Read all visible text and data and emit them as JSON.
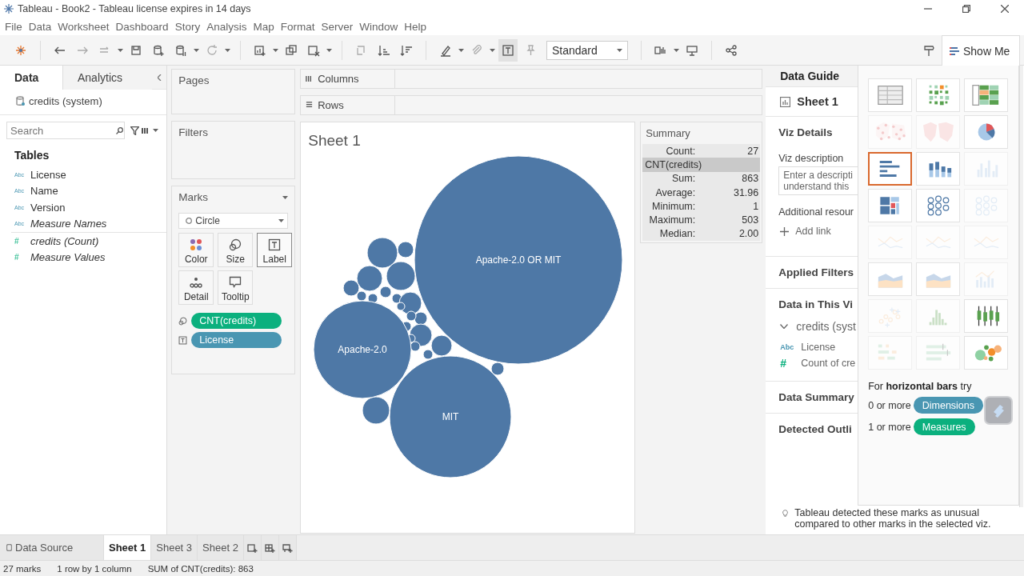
{
  "window": {
    "title": "Tableau - Book2 - Tableau license expires in 14 days"
  },
  "menu": [
    "File",
    "Data",
    "Worksheet",
    "Dashboard",
    "Story",
    "Analysis",
    "Map",
    "Format",
    "Server",
    "Window",
    "Help"
  ],
  "toolbar": {
    "view_mode": "Standard",
    "show_me_tab": "Show Me"
  },
  "data_pane": {
    "tabs": [
      {
        "label": "Data",
        "selected": true
      },
      {
        "label": "Analytics",
        "selected": false
      }
    ],
    "source": "credits (system)",
    "search": {
      "placeholder": "Search"
    },
    "heading": "Tables",
    "fields": [
      {
        "name": "License",
        "kind": "dimension",
        "icon_text": "Abc",
        "generated": false
      },
      {
        "name": "Name",
        "kind": "dimension",
        "icon_text": "Abc",
        "generated": false
      },
      {
        "name": "Version",
        "kind": "dimension",
        "icon_text": "Abc",
        "generated": false
      },
      {
        "name": "Measure Names",
        "kind": "dimension",
        "icon_text": "Abc",
        "generated": true
      },
      {
        "name": "credits (Count)",
        "kind": "measure",
        "icon_text": "#",
        "generated": true
      },
      {
        "name": "Measure Values",
        "kind": "measure",
        "icon_text": "#",
        "generated": true
      }
    ]
  },
  "shelves": {
    "pages": "Pages",
    "filters": "Filters",
    "columns": "Columns",
    "rows": "Rows"
  },
  "marks": {
    "title": "Marks",
    "mark_type": "Circle",
    "buttons": [
      {
        "label": "Color",
        "kind": "color",
        "selected": false
      },
      {
        "label": "Size",
        "kind": "size",
        "selected": false
      },
      {
        "label": "Label",
        "kind": "label",
        "selected": true
      },
      {
        "label": "Detail",
        "kind": "detail",
        "selected": false
      },
      {
        "label": "Tooltip",
        "kind": "tooltip",
        "selected": false
      }
    ],
    "pills": [
      {
        "label": "CNT(credits)",
        "kind": "size",
        "color": "#0bb07e"
      },
      {
        "label": "License",
        "kind": "label",
        "color": "#4996b2"
      }
    ]
  },
  "sheet": {
    "title": "Sheet 1",
    "bubbles": [
      {
        "label": "Apache-2.0 OR MIT"
      },
      {
        "label": "Apache-2.0"
      },
      {
        "label": "MIT"
      }
    ]
  },
  "summary": {
    "title": "Summary",
    "rows": [
      {
        "kind": "stat",
        "label": "Count:",
        "value": "27"
      },
      {
        "kind": "header",
        "label": "CNT(credits)"
      },
      {
        "kind": "stat",
        "label": "Sum:",
        "value": "863"
      },
      {
        "kind": "stat",
        "label": "Average:",
        "value": "31.96"
      },
      {
        "kind": "stat",
        "label": "Minimum:",
        "value": "1"
      },
      {
        "kind": "stat",
        "label": "Maximum:",
        "value": "503"
      },
      {
        "kind": "stat",
        "label": "Median:",
        "value": "2.00"
      }
    ]
  },
  "data_guide": {
    "tab": "Data Guide",
    "sheet": "Sheet 1",
    "viz_details": "Viz Details",
    "description_label": "Viz description",
    "description_placeholder": [
      "Enter a descripti",
      "understand this"
    ],
    "resources_label": "Additional resour",
    "add_link": "Add link",
    "sections": [
      "Applied Filters",
      "Data in This Vi"
    ],
    "source": "credits (syst",
    "fields": [
      {
        "icon_text": "Abc",
        "kind": "dimension",
        "name": "License"
      },
      {
        "icon_text": "#",
        "kind": "measure",
        "name": "Count of cre"
      }
    ],
    "more_sections": [
      "Data Summary",
      "Detected Outli"
    ],
    "outlier_text": "Tableau detected these marks as unusual compared to other marks in the selected viz."
  },
  "show_me": {
    "charts": [
      {
        "selected": false,
        "disabled": false
      },
      {
        "selected": false,
        "disabled": false
      },
      {
        "selected": false,
        "disabled": false
      },
      {
        "selected": false,
        "disabled": true
      },
      {
        "selected": false,
        "disabled": true
      },
      {
        "selected": false,
        "disabled": false
      },
      {
        "selected": true,
        "disabled": false
      },
      {
        "selected": false,
        "disabled": false
      },
      {
        "selected": false,
        "disabled": true
      },
      {
        "selected": false,
        "disabled": false
      },
      {
        "selected": false,
        "disabled": false
      },
      {
        "selected": false,
        "disabled": true
      },
      {
        "selected": false,
        "disabled": true
      },
      {
        "selected": false,
        "disabled": true
      },
      {
        "selected": false,
        "disabled": true
      },
      {
        "selected": false,
        "disabled": false
      },
      {
        "selected": false,
        "disabled": false
      },
      {
        "selected": false,
        "disabled": true
      },
      {
        "selected": false,
        "disabled": true
      },
      {
        "selected": false,
        "disabled": true
      },
      {
        "selected": false,
        "disabled": false
      },
      {
        "selected": false,
        "disabled": true
      },
      {
        "selected": false,
        "disabled": true
      },
      {
        "selected": false,
        "disabled": false
      }
    ],
    "hint": "For **horizontal bars** try",
    "requirements": [
      {
        "count": "0 or more",
        "pill": "Dimensions",
        "kind": "dimension"
      },
      {
        "count": "1 or more",
        "pill": "Measures",
        "kind": "measure"
      }
    ]
  },
  "sheet_tabs": [
    {
      "label": "Data Source",
      "kind": "source",
      "selected": false
    },
    {
      "label": "Sheet 1",
      "kind": "sheet",
      "selected": true
    },
    {
      "label": "Sheet 3",
      "kind": "sheet",
      "selected": false
    },
    {
      "label": "Sheet 2",
      "kind": "sheet",
      "selected": false
    }
  ],
  "status_bar": [
    "27 marks",
    "1 row by 1 column",
    "SUM of CNT(credits): 863"
  ]
}
